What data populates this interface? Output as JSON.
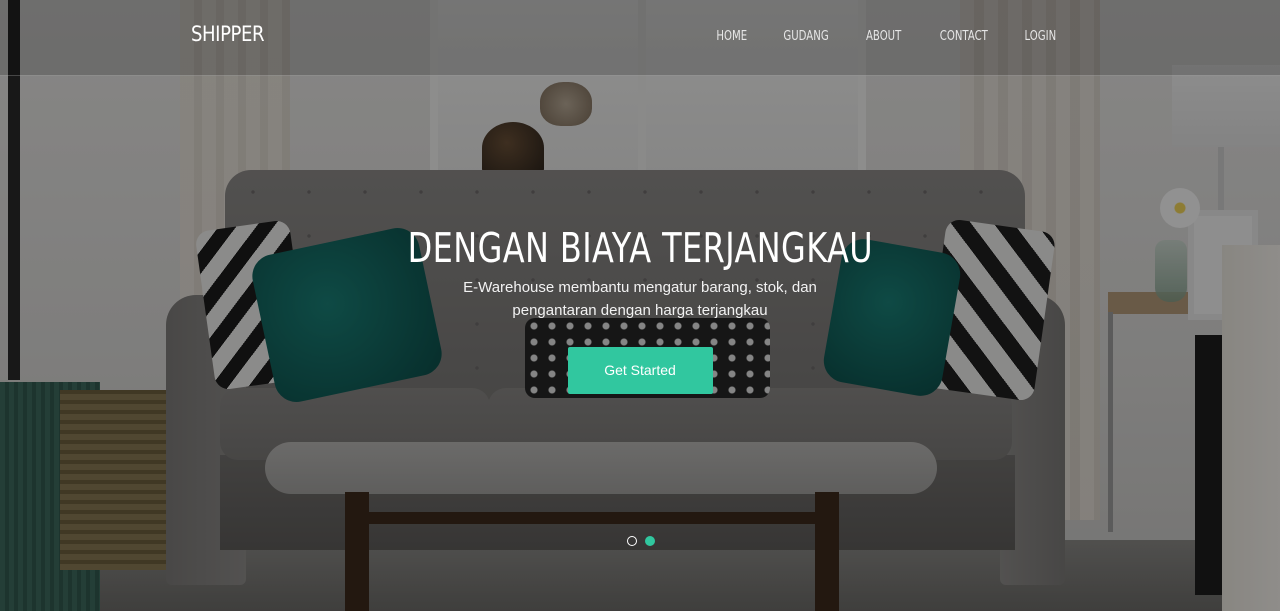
{
  "navbar": {
    "brand": "SHIPPER",
    "links": [
      "HOME",
      "GUDANG",
      "ABOUT",
      "CONTACT",
      "LOGIN"
    ]
  },
  "hero": {
    "headline": "DENGAN BIAYA TERJANGKAU",
    "subtitle": "E-Warehouse membantu mengatur barang, stok, dan pengantaran dengan harga terjangkau",
    "cta_label": "Get Started"
  },
  "carousel": {
    "slide_count": 2,
    "active_index": 1
  },
  "colors": {
    "accent": "#31c79f",
    "text": "#ffffff"
  }
}
